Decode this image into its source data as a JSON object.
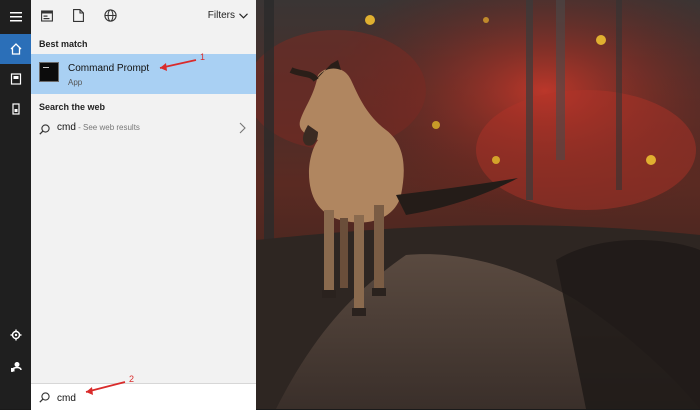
{
  "sidebar": {
    "icons": [
      "hamburger-menu-icon",
      "home-icon",
      "notebook-icon",
      "documents-icon",
      "settings-icon",
      "user-icon"
    ]
  },
  "topbar": {
    "filters_label": "Filters"
  },
  "best_match": {
    "section_label": "Best match",
    "title": "Command Prompt",
    "subtitle": "App"
  },
  "web": {
    "section_label": "Search the web",
    "query": "cmd",
    "suffix": " - See web results"
  },
  "search": {
    "value": "cmd"
  },
  "annotations": {
    "one": "1",
    "two": "2"
  },
  "colors": {
    "selection": "#a9d0f3",
    "accent": "#2b6fb8",
    "annotation": "#d92b2b"
  }
}
